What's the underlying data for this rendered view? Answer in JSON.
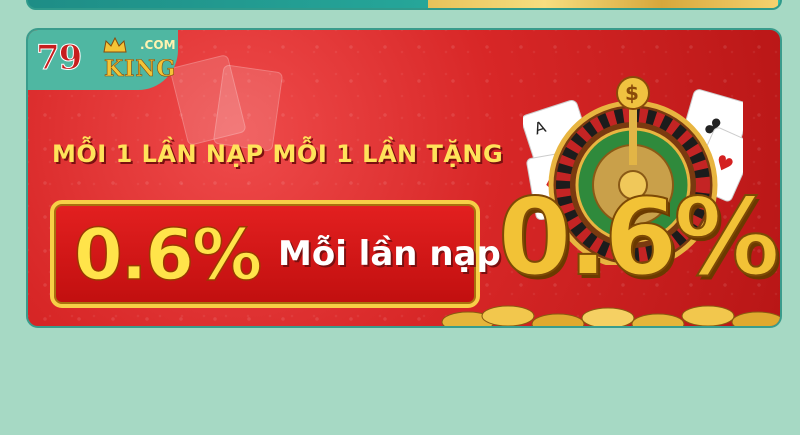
{
  "banner": {
    "logo": {
      "number": "79",
      "com": ".COM",
      "word": "KING"
    },
    "headline": "MỖI 1 LẦN NẠP MỖI 1 LẦN TẶNG",
    "offer_percent": "0.6%",
    "offer_label": "Mỗi lần nạp",
    "big_percent": "0.6%"
  },
  "colors": {
    "page_background": "#a6d9c4",
    "banner_red": "#d82727",
    "gold": "#f2c236",
    "headline_yellow": "#ffe35a"
  }
}
